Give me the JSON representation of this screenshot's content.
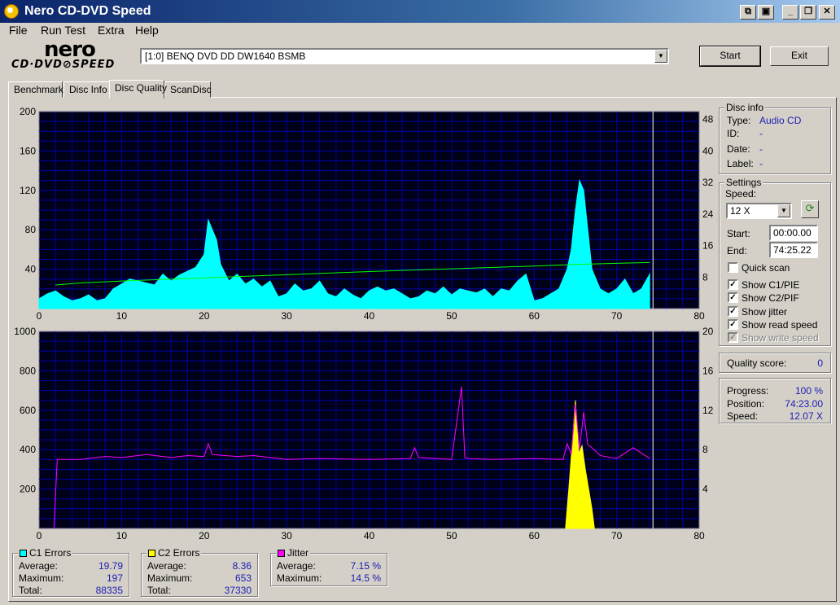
{
  "window": {
    "title": "Nero CD-DVD Speed"
  },
  "menu": [
    "File",
    "Run Test",
    "Extra",
    "Help"
  ],
  "logo": {
    "brand": "nero",
    "product": "CD·DVD⊘SPEED"
  },
  "drive": {
    "selected": "[1:0]   BENQ DVD DD DW1640 BSMB"
  },
  "buttons": {
    "start": "Start",
    "exit": "Exit"
  },
  "tabs": [
    "Benchmark",
    "Disc Info",
    "Disc Quality",
    "ScanDisc"
  ],
  "active_tab": "Disc Quality",
  "disc_info": {
    "title": "Disc info",
    "rows": [
      {
        "label": "Type:",
        "value": "Audio CD"
      },
      {
        "label": "ID:",
        "value": "-"
      },
      {
        "label": "Date:",
        "value": "-"
      },
      {
        "label": "Label:",
        "value": "-"
      }
    ]
  },
  "settings": {
    "title": "Settings",
    "speed_label": "Speed:",
    "speed_value": "12 X",
    "start_label": "Start:",
    "start_value": "00:00.00",
    "end_label": "End:",
    "end_value": "74:25.22",
    "checkboxes": [
      {
        "label": "Quick scan",
        "checked": false,
        "enabled": true
      },
      {
        "label": "Show C1/PIE",
        "checked": true,
        "enabled": true
      },
      {
        "label": "Show C2/PIF",
        "checked": true,
        "enabled": true
      },
      {
        "label": "Show jitter",
        "checked": true,
        "enabled": true
      },
      {
        "label": "Show read speed",
        "checked": true,
        "enabled": true
      },
      {
        "label": "Show write speed",
        "checked": true,
        "enabled": false
      }
    ]
  },
  "quality": {
    "label": "Quality score:",
    "value": "0"
  },
  "progress": {
    "rows": [
      {
        "label": "Progress:",
        "value": "100 %"
      },
      {
        "label": "Position:",
        "value": "74:23.00"
      },
      {
        "label": "Speed:",
        "value": "12.07 X"
      }
    ]
  },
  "stats": {
    "c1": {
      "title": "C1 Errors",
      "color": "#00ffff",
      "rows": [
        {
          "label": "Average:",
          "value": "19.79"
        },
        {
          "label": "Maximum:",
          "value": "197"
        },
        {
          "label": "Total:",
          "value": "88335"
        }
      ]
    },
    "c2": {
      "title": "C2 Errors",
      "color": "#ffff00",
      "rows": [
        {
          "label": "Average:",
          "value": "8.36"
        },
        {
          "label": "Maximum:",
          "value": "653"
        },
        {
          "label": "Total:",
          "value": "37330"
        }
      ]
    },
    "jitter": {
      "title": "Jitter",
      "color": "#ff00ff",
      "rows": [
        {
          "label": "Average:",
          "value": "7.15 %"
        },
        {
          "label": "Maximum:",
          "value": "14.5 %"
        }
      ]
    }
  },
  "chart_data": [
    {
      "type": "area",
      "x_ticks": [
        0,
        10,
        20,
        30,
        40,
        50,
        60,
        70,
        80
      ],
      "y_ticks": [
        40,
        80,
        120,
        160,
        200
      ],
      "y2_ticks": [
        8,
        16,
        24,
        32,
        40,
        48
      ],
      "xlim": [
        0,
        80
      ],
      "ylim": [
        0,
        200
      ],
      "y2lim": [
        0,
        50
      ],
      "grid": true,
      "end_marker_x": 74.4,
      "series": [
        {
          "color": "#00ffff",
          "kind": "area",
          "x": [
            0,
            1,
            2,
            3,
            4,
            5,
            6,
            7,
            8,
            9,
            10,
            11,
            12,
            13,
            14,
            15,
            16,
            17,
            18,
            19,
            20,
            20.5,
            21,
            21.5,
            22,
            23,
            24,
            25,
            26,
            27,
            28,
            29,
            30,
            31,
            32,
            33,
            34,
            35,
            36,
            37,
            38,
            39,
            40,
            41,
            42,
            43,
            44,
            45,
            46,
            47,
            48,
            49,
            50,
            51,
            52,
            53,
            54,
            55,
            56,
            57,
            58,
            59,
            60,
            61,
            62,
            63,
            64,
            64.5,
            65,
            65.5,
            66,
            66.5,
            67,
            68,
            69,
            70,
            71,
            72,
            73,
            74
          ],
          "y": [
            10,
            15,
            18,
            12,
            8,
            10,
            14,
            8,
            10,
            20,
            25,
            30,
            28,
            26,
            24,
            35,
            28,
            34,
            38,
            42,
            55,
            90,
            80,
            70,
            45,
            28,
            35,
            25,
            30,
            22,
            28,
            12,
            15,
            25,
            18,
            20,
            28,
            15,
            12,
            20,
            14,
            10,
            18,
            22,
            18,
            20,
            15,
            10,
            12,
            18,
            15,
            22,
            14,
            20,
            18,
            16,
            20,
            12,
            20,
            18,
            28,
            35,
            8,
            10,
            15,
            20,
            40,
            60,
            100,
            130,
            120,
            80,
            40,
            20,
            15,
            20,
            30,
            15,
            20,
            35
          ]
        },
        {
          "color": "#00ff00",
          "kind": "line",
          "axis": "y2",
          "x": [
            2,
            5,
            10,
            20,
            30,
            40,
            50,
            60,
            65,
            70,
            74
          ],
          "y": [
            6,
            6.5,
            7,
            7.8,
            8.6,
            9.4,
            10.1,
            10.8,
            11.2,
            11.5,
            11.7
          ]
        }
      ]
    },
    {
      "type": "area",
      "x_ticks": [
        0,
        10,
        20,
        30,
        40,
        50,
        60,
        70,
        80
      ],
      "y_ticks": [
        200,
        400,
        600,
        800,
        1000
      ],
      "y2_ticks": [
        4,
        8,
        12,
        16,
        20
      ],
      "xlim": [
        0,
        80
      ],
      "ylim": [
        0,
        1000
      ],
      "y2lim": [
        0,
        20
      ],
      "grid": true,
      "end_marker_x": 74.4,
      "series": [
        {
          "color": "#ffff00",
          "kind": "area",
          "x": [
            63.8,
            64.2,
            64.6,
            65,
            65.4,
            65.8,
            66.2,
            66.6,
            67,
            67.3
          ],
          "y": [
            0,
            200,
            420,
            650,
            380,
            420,
            300,
            200,
            100,
            0
          ]
        },
        {
          "color": "#ff00ff",
          "kind": "line",
          "axis": "y2",
          "x": [
            1.8,
            2.2,
            5,
            8,
            10,
            13,
            16,
            18,
            20,
            20.5,
            21,
            24,
            26,
            30,
            34,
            40,
            45,
            45.5,
            46,
            50,
            51.2,
            51.6,
            52,
            55,
            60,
            63.5,
            64,
            64.5,
            65,
            65.5,
            66,
            66.5,
            67,
            68,
            70,
            72,
            74
          ],
          "y": [
            0,
            7,
            7,
            7.3,
            7.2,
            7.5,
            7.2,
            7.4,
            7.3,
            8.6,
            7.5,
            7.3,
            7.4,
            7,
            7.1,
            7,
            7.1,
            8.2,
            7.2,
            7,
            14.4,
            7.2,
            7.1,
            7,
            7.1,
            7,
            8.6,
            7.5,
            12.6,
            8,
            11.8,
            8.5,
            8.2,
            7.4,
            7.1,
            8.2,
            7.1
          ]
        }
      ]
    }
  ]
}
